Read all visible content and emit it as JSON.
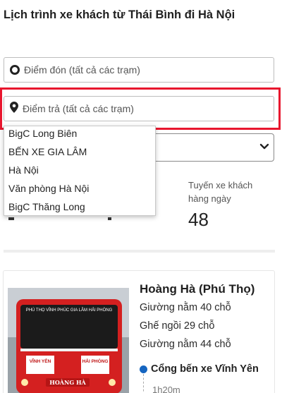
{
  "page": {
    "title": "Lịch trình xe khách từ Thái Bình đi Hà Nội"
  },
  "search": {
    "pickup_placeholder": "Điểm đón (tất cả các trạm)",
    "dropoff_placeholder": "Điểm trả (tất cả các trạm)"
  },
  "dropdown": {
    "options": [
      "BigC Long Biên",
      "BẾN XE GIA LÂM",
      "Hà Nội",
      "Văn phòng Hà Nội",
      "BigC Thăng Long"
    ]
  },
  "stats": {
    "routes_label": "Tuyến xe khách hàng ngày",
    "routes_value": "48"
  },
  "card": {
    "operator": "Hoàng Hà (Phú Thọ)",
    "seats": [
      "Giường nằm 40 chỗ",
      "Ghế ngồi 29 chỗ",
      "Giường nằm 44 chỗ"
    ],
    "departure": "Cổng bến xe Vĩnh Yên",
    "duration": "1h20m",
    "bus_signs": {
      "top": "PHÚ THỌ  VĨNH PHÚC  GIA LÂM  HẢI PHÒNG",
      "left_panel": "VĨNH YÊN",
      "right_panel": "HẢI PHÒNG",
      "brand": "HOÀNG HÀ"
    }
  },
  "colors": {
    "highlight": "#e8162e",
    "route_dot": "#1565c0"
  }
}
